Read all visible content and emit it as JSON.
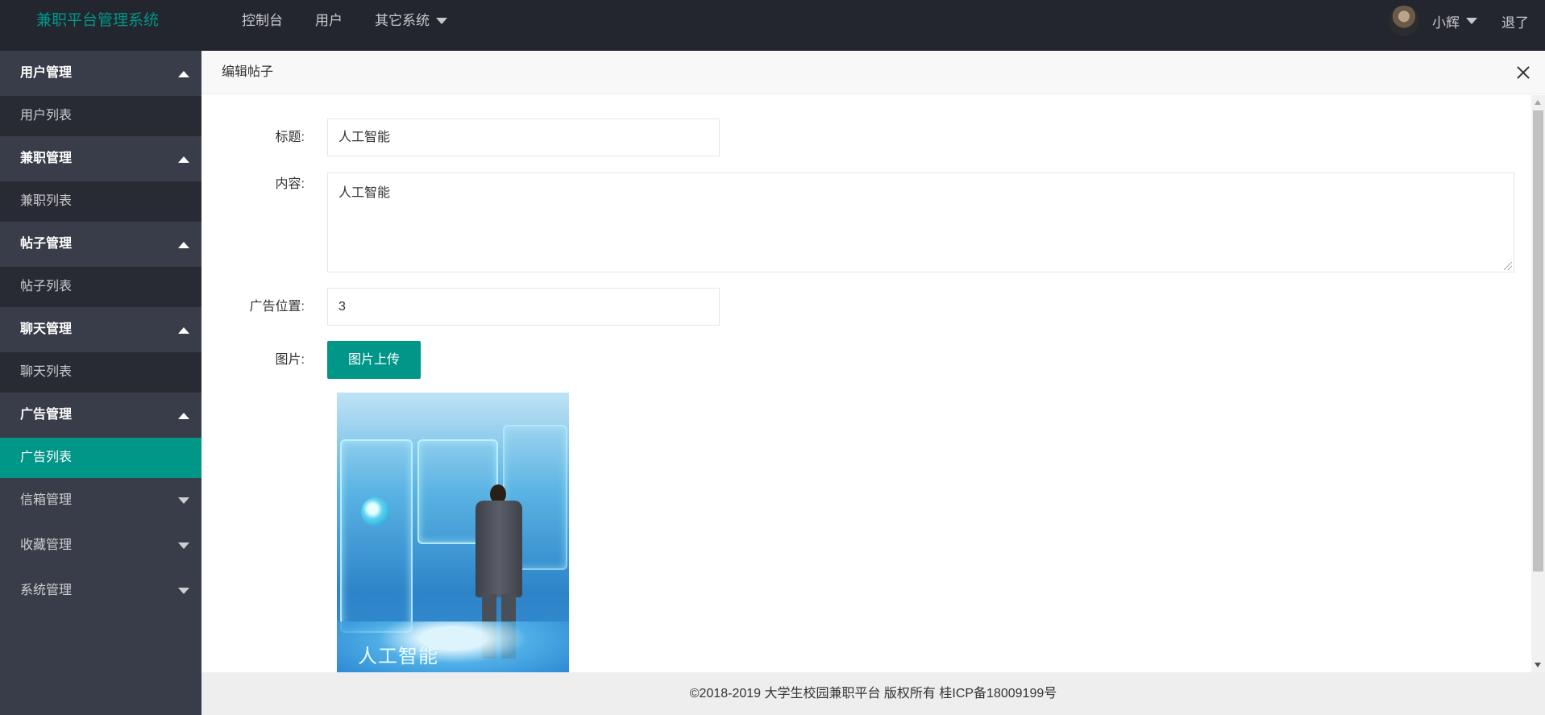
{
  "header": {
    "logo": "兼职平台管理系统",
    "nav": [
      {
        "label": "控制台"
      },
      {
        "label": "用户"
      },
      {
        "label": "其它系统"
      }
    ],
    "user_name": "小辉",
    "logout": "退了"
  },
  "sidebar": {
    "groups": [
      {
        "label": "用户管理",
        "expanded": true,
        "child": "用户列表"
      },
      {
        "label": "兼职管理",
        "expanded": true,
        "child": "兼职列表"
      },
      {
        "label": "帖子管理",
        "expanded": true,
        "child": "帖子列表"
      },
      {
        "label": "聊天管理",
        "expanded": true,
        "child": "聊天列表"
      },
      {
        "label": "广告管理",
        "expanded": true,
        "child": "广告列表",
        "active_child": true
      },
      {
        "label": "信箱管理",
        "expanded": false
      },
      {
        "label": "收藏管理",
        "expanded": false
      },
      {
        "label": "系统管理",
        "expanded": false
      }
    ]
  },
  "dialog": {
    "title": "编辑帖子",
    "fields": {
      "title_label": "标题:",
      "title_value": "人工智能",
      "content_label": "内容:",
      "content_value": "人工智能",
      "position_label": "广告位置:",
      "position_value": "3",
      "image_label": "图片:",
      "upload_button": "图片上传"
    },
    "image_caption": "人工智能"
  },
  "footer": "©2018-2019 大学生校园兼职平台 版权所有 桂ICP备18009199号",
  "colors": {
    "header_bg": "#23262e",
    "sidebar_bg": "#393d49",
    "accent": "#009688"
  }
}
